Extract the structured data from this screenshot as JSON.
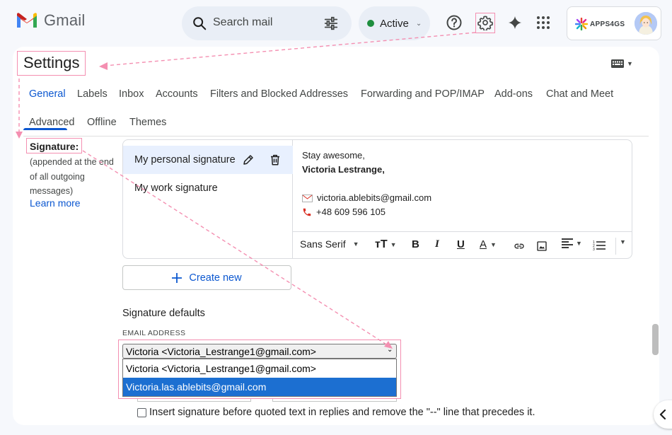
{
  "header": {
    "app_name": "Gmail",
    "search_placeholder": "Search mail",
    "status_label": "Active",
    "account_label": "APPS4GS"
  },
  "settings": {
    "title": "Settings",
    "tabs_row1": [
      {
        "label": "General",
        "active": true
      },
      {
        "label": "Labels"
      },
      {
        "label": "Inbox"
      },
      {
        "label": "Accounts"
      },
      {
        "label": "Filters and Blocked Addresses"
      },
      {
        "label": "Forwarding and POP/IMAP"
      },
      {
        "label": "Add-ons"
      },
      {
        "label": "Chat and Meet"
      }
    ],
    "tabs_row2": [
      {
        "label": "Advanced"
      },
      {
        "label": "Offline"
      },
      {
        "label": "Themes"
      }
    ]
  },
  "signature": {
    "label": "Signature:",
    "note": "(appended at the end of all outgoing messages)",
    "learn_more": "Learn more",
    "items": [
      {
        "name": "My personal signature",
        "selected": true
      },
      {
        "name": "My work signature"
      }
    ],
    "editor": {
      "line1": "Stay awesome,",
      "line2": "Victoria Lestrange,",
      "email": "victoria.ablebits@gmail.com",
      "phone": "+48 609 596 105"
    },
    "toolbar": {
      "font": "Sans Serif"
    },
    "create_new": "Create new"
  },
  "defaults": {
    "title": "Signature defaults",
    "email_label": "EMAIL ADDRESS",
    "selected_value": "Victoria <Victoria_Lestrange1@gmail.com>",
    "options": [
      "Victoria <Victoria_Lestrange1@gmail.com>",
      "Victoria.las.ablebits@gmail.com"
    ],
    "highlighted_option": 1,
    "insert_before_quoted": "Insert signature before quoted text in replies and remove the \"--\" line that precedes it."
  },
  "colors": {
    "accent_blue": "#0b57d0",
    "annotation_pink": "#f48fb1",
    "active_green": "#1e8e3e",
    "selected_option": "#1c6fd1"
  }
}
